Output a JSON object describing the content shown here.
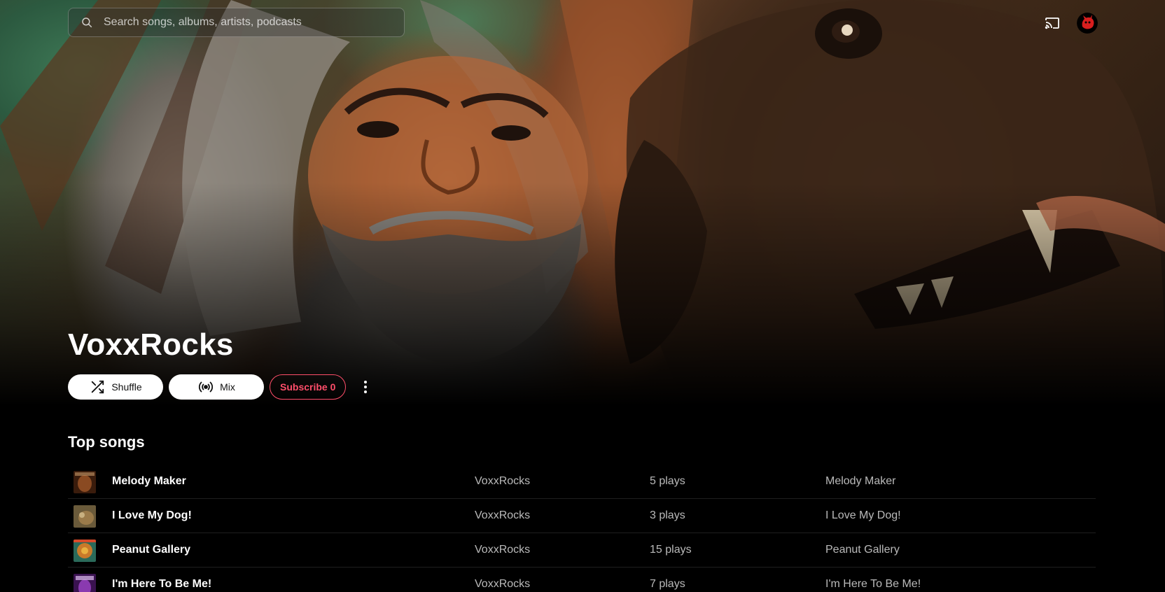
{
  "search": {
    "placeholder": "Search songs, albums, artists, podcasts"
  },
  "header": {
    "cast_icon": "cast-icon",
    "avatar_icon": "avatar-icon"
  },
  "artist": {
    "name": "VoxxRocks",
    "shuffle_label": "Shuffle",
    "mix_label": "Mix",
    "subscribe_label": "Subscribe 0",
    "more_icon": "more-vert-icon",
    "accent_color": "#ff4e6a"
  },
  "top_songs": {
    "heading": "Top songs",
    "items": [
      {
        "title": "Melody Maker",
        "artist": "VoxxRocks",
        "plays": "5 plays",
        "album": "Melody Maker",
        "thumb_color": "#8a4a22"
      },
      {
        "title": "I Love My Dog!",
        "artist": "VoxxRocks",
        "plays": "3 plays",
        "album": "I Love My Dog!",
        "thumb_color": "#9a7a4a"
      },
      {
        "title": "Peanut Gallery",
        "artist": "VoxxRocks",
        "plays": "15 plays",
        "album": "Peanut Gallery",
        "thumb_color": "#c97a2a"
      },
      {
        "title": "I'm Here To Be Me!",
        "artist": "VoxxRocks",
        "plays": "7 plays",
        "album": "I'm Here To Be Me!",
        "thumb_color": "#6a2a8a"
      }
    ]
  }
}
